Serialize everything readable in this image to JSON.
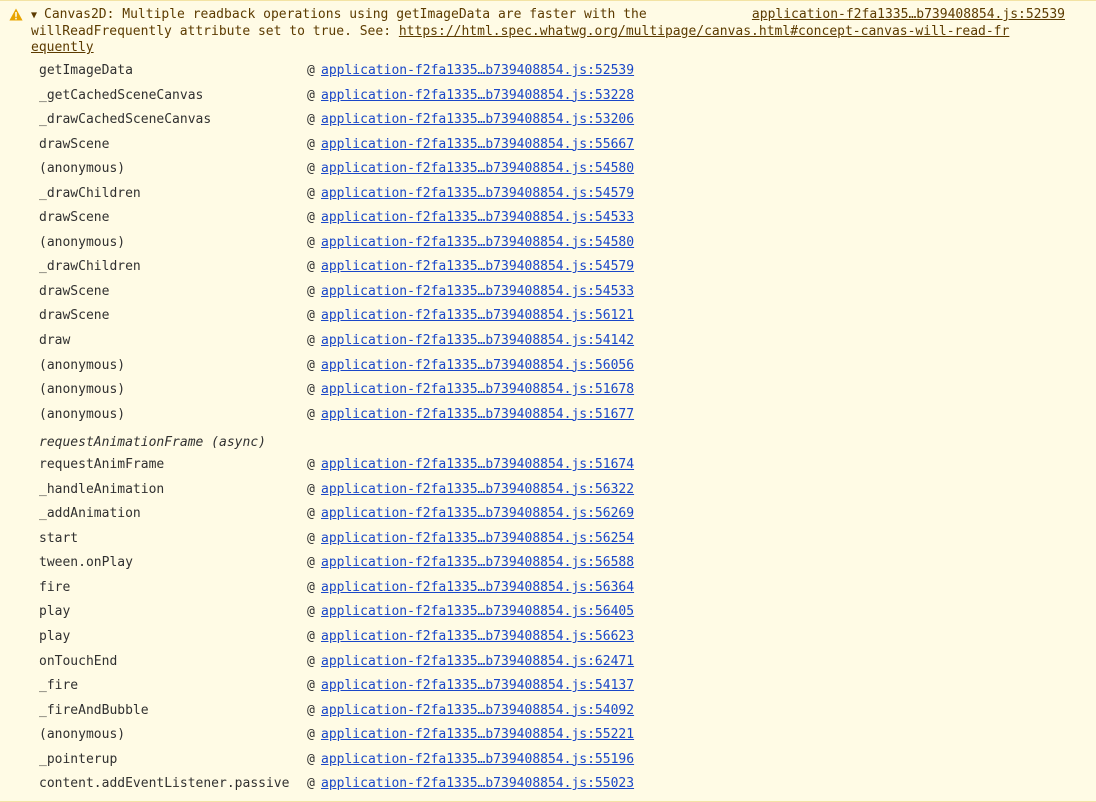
{
  "warning": {
    "icon": "warning-triangle-icon",
    "disclosure": "▼",
    "message_line1": "Canvas2D: Multiple readback operations using getImageData are faster with the",
    "message_line2_prefix": "willReadFrequently attribute set to true. See: ",
    "message_link_part1": "https://html.spec.whatwg.org/multipage/canvas.html#concept-canvas-will-read-fr",
    "message_link_part2": "equently",
    "source": "application-f2fa1335…b739408854.js:52539"
  },
  "colors": {
    "background": "#fffbe5",
    "text": "#5c3b00",
    "link": "#1a47c8",
    "icon": "#e8a400"
  },
  "trace_group1": [
    {
      "fn": "getImageData",
      "loc": "application-f2fa1335…b739408854.js:52539"
    },
    {
      "fn": "_getCachedSceneCanvas",
      "loc": "application-f2fa1335…b739408854.js:53228"
    },
    {
      "fn": "_drawCachedSceneCanvas",
      "loc": "application-f2fa1335…b739408854.js:53206"
    },
    {
      "fn": "drawScene",
      "loc": "application-f2fa1335…b739408854.js:55667"
    },
    {
      "fn": "(anonymous)",
      "loc": "application-f2fa1335…b739408854.js:54580"
    },
    {
      "fn": "_drawChildren",
      "loc": "application-f2fa1335…b739408854.js:54579"
    },
    {
      "fn": "drawScene",
      "loc": "application-f2fa1335…b739408854.js:54533"
    },
    {
      "fn": "(anonymous)",
      "loc": "application-f2fa1335…b739408854.js:54580"
    },
    {
      "fn": "_drawChildren",
      "loc": "application-f2fa1335…b739408854.js:54579"
    },
    {
      "fn": "drawScene",
      "loc": "application-f2fa1335…b739408854.js:54533"
    },
    {
      "fn": "drawScene",
      "loc": "application-f2fa1335…b739408854.js:56121"
    },
    {
      "fn": "draw",
      "loc": "application-f2fa1335…b739408854.js:54142"
    },
    {
      "fn": "(anonymous)",
      "loc": "application-f2fa1335…b739408854.js:56056"
    },
    {
      "fn": "(anonymous)",
      "loc": "application-f2fa1335…b739408854.js:51678"
    },
    {
      "fn": "(anonymous)",
      "loc": "application-f2fa1335…b739408854.js:51677"
    }
  ],
  "async_label": "requestAnimationFrame (async)",
  "trace_group2": [
    {
      "fn": "requestAnimFrame",
      "loc": "application-f2fa1335…b739408854.js:51674"
    },
    {
      "fn": "_handleAnimation",
      "loc": "application-f2fa1335…b739408854.js:56322"
    },
    {
      "fn": "_addAnimation",
      "loc": "application-f2fa1335…b739408854.js:56269"
    },
    {
      "fn": "start",
      "loc": "application-f2fa1335…b739408854.js:56254"
    },
    {
      "fn": "tween.onPlay",
      "loc": "application-f2fa1335…b739408854.js:56588"
    },
    {
      "fn": "fire",
      "loc": "application-f2fa1335…b739408854.js:56364"
    },
    {
      "fn": "play",
      "loc": "application-f2fa1335…b739408854.js:56405"
    },
    {
      "fn": "play",
      "loc": "application-f2fa1335…b739408854.js:56623"
    },
    {
      "fn": "onTouchEnd",
      "loc": "application-f2fa1335…b739408854.js:62471"
    },
    {
      "fn": "_fire",
      "loc": "application-f2fa1335…b739408854.js:54137"
    },
    {
      "fn": "_fireAndBubble",
      "loc": "application-f2fa1335…b739408854.js:54092"
    },
    {
      "fn": "(anonymous)",
      "loc": "application-f2fa1335…b739408854.js:55221"
    },
    {
      "fn": "_pointerup",
      "loc": "application-f2fa1335…b739408854.js:55196"
    },
    {
      "fn": "content.addEventListener.passive",
      "loc": "application-f2fa1335…b739408854.js:55023"
    }
  ],
  "at_symbol": "@"
}
